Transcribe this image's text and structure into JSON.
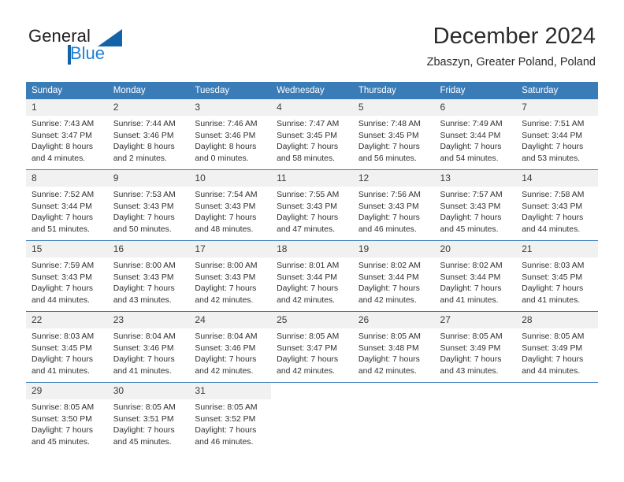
{
  "brand": {
    "name_primary": "General",
    "name_secondary": "Blue",
    "accent_color": "#1363a8",
    "blue_text_color": "#1f7fd4"
  },
  "header": {
    "title": "December 2024",
    "subtitle": "Zbaszyn, Greater Poland, Poland"
  },
  "calendar": {
    "header_bg": "#3a7cb8",
    "daynum_bg": "#f1f1f1",
    "weekday_headers": [
      "Sunday",
      "Monday",
      "Tuesday",
      "Wednesday",
      "Thursday",
      "Friday",
      "Saturday"
    ],
    "weeks": [
      [
        {
          "day": "1",
          "sunrise": "Sunrise: 7:43 AM",
          "sunset": "Sunset: 3:47 PM",
          "daylight": "Daylight: 8 hours and 4 minutes."
        },
        {
          "day": "2",
          "sunrise": "Sunrise: 7:44 AM",
          "sunset": "Sunset: 3:46 PM",
          "daylight": "Daylight: 8 hours and 2 minutes."
        },
        {
          "day": "3",
          "sunrise": "Sunrise: 7:46 AM",
          "sunset": "Sunset: 3:46 PM",
          "daylight": "Daylight: 8 hours and 0 minutes."
        },
        {
          "day": "4",
          "sunrise": "Sunrise: 7:47 AM",
          "sunset": "Sunset: 3:45 PM",
          "daylight": "Daylight: 7 hours and 58 minutes."
        },
        {
          "day": "5",
          "sunrise": "Sunrise: 7:48 AM",
          "sunset": "Sunset: 3:45 PM",
          "daylight": "Daylight: 7 hours and 56 minutes."
        },
        {
          "day": "6",
          "sunrise": "Sunrise: 7:49 AM",
          "sunset": "Sunset: 3:44 PM",
          "daylight": "Daylight: 7 hours and 54 minutes."
        },
        {
          "day": "7",
          "sunrise": "Sunrise: 7:51 AM",
          "sunset": "Sunset: 3:44 PM",
          "daylight": "Daylight: 7 hours and 53 minutes."
        }
      ],
      [
        {
          "day": "8",
          "sunrise": "Sunrise: 7:52 AM",
          "sunset": "Sunset: 3:44 PM",
          "daylight": "Daylight: 7 hours and 51 minutes."
        },
        {
          "day": "9",
          "sunrise": "Sunrise: 7:53 AM",
          "sunset": "Sunset: 3:43 PM",
          "daylight": "Daylight: 7 hours and 50 minutes."
        },
        {
          "day": "10",
          "sunrise": "Sunrise: 7:54 AM",
          "sunset": "Sunset: 3:43 PM",
          "daylight": "Daylight: 7 hours and 48 minutes."
        },
        {
          "day": "11",
          "sunrise": "Sunrise: 7:55 AM",
          "sunset": "Sunset: 3:43 PM",
          "daylight": "Daylight: 7 hours and 47 minutes."
        },
        {
          "day": "12",
          "sunrise": "Sunrise: 7:56 AM",
          "sunset": "Sunset: 3:43 PM",
          "daylight": "Daylight: 7 hours and 46 minutes."
        },
        {
          "day": "13",
          "sunrise": "Sunrise: 7:57 AM",
          "sunset": "Sunset: 3:43 PM",
          "daylight": "Daylight: 7 hours and 45 minutes."
        },
        {
          "day": "14",
          "sunrise": "Sunrise: 7:58 AM",
          "sunset": "Sunset: 3:43 PM",
          "daylight": "Daylight: 7 hours and 44 minutes."
        }
      ],
      [
        {
          "day": "15",
          "sunrise": "Sunrise: 7:59 AM",
          "sunset": "Sunset: 3:43 PM",
          "daylight": "Daylight: 7 hours and 44 minutes."
        },
        {
          "day": "16",
          "sunrise": "Sunrise: 8:00 AM",
          "sunset": "Sunset: 3:43 PM",
          "daylight": "Daylight: 7 hours and 43 minutes."
        },
        {
          "day": "17",
          "sunrise": "Sunrise: 8:00 AM",
          "sunset": "Sunset: 3:43 PM",
          "daylight": "Daylight: 7 hours and 42 minutes."
        },
        {
          "day": "18",
          "sunrise": "Sunrise: 8:01 AM",
          "sunset": "Sunset: 3:44 PM",
          "daylight": "Daylight: 7 hours and 42 minutes."
        },
        {
          "day": "19",
          "sunrise": "Sunrise: 8:02 AM",
          "sunset": "Sunset: 3:44 PM",
          "daylight": "Daylight: 7 hours and 42 minutes."
        },
        {
          "day": "20",
          "sunrise": "Sunrise: 8:02 AM",
          "sunset": "Sunset: 3:44 PM",
          "daylight": "Daylight: 7 hours and 41 minutes."
        },
        {
          "day": "21",
          "sunrise": "Sunrise: 8:03 AM",
          "sunset": "Sunset: 3:45 PM",
          "daylight": "Daylight: 7 hours and 41 minutes."
        }
      ],
      [
        {
          "day": "22",
          "sunrise": "Sunrise: 8:03 AM",
          "sunset": "Sunset: 3:45 PM",
          "daylight": "Daylight: 7 hours and 41 minutes."
        },
        {
          "day": "23",
          "sunrise": "Sunrise: 8:04 AM",
          "sunset": "Sunset: 3:46 PM",
          "daylight": "Daylight: 7 hours and 41 minutes."
        },
        {
          "day": "24",
          "sunrise": "Sunrise: 8:04 AM",
          "sunset": "Sunset: 3:46 PM",
          "daylight": "Daylight: 7 hours and 42 minutes."
        },
        {
          "day": "25",
          "sunrise": "Sunrise: 8:05 AM",
          "sunset": "Sunset: 3:47 PM",
          "daylight": "Daylight: 7 hours and 42 minutes."
        },
        {
          "day": "26",
          "sunrise": "Sunrise: 8:05 AM",
          "sunset": "Sunset: 3:48 PM",
          "daylight": "Daylight: 7 hours and 42 minutes."
        },
        {
          "day": "27",
          "sunrise": "Sunrise: 8:05 AM",
          "sunset": "Sunset: 3:49 PM",
          "daylight": "Daylight: 7 hours and 43 minutes."
        },
        {
          "day": "28",
          "sunrise": "Sunrise: 8:05 AM",
          "sunset": "Sunset: 3:49 PM",
          "daylight": "Daylight: 7 hours and 44 minutes."
        }
      ],
      [
        {
          "day": "29",
          "sunrise": "Sunrise: 8:05 AM",
          "sunset": "Sunset: 3:50 PM",
          "daylight": "Daylight: 7 hours and 45 minutes."
        },
        {
          "day": "30",
          "sunrise": "Sunrise: 8:05 AM",
          "sunset": "Sunset: 3:51 PM",
          "daylight": "Daylight: 7 hours and 45 minutes."
        },
        {
          "day": "31",
          "sunrise": "Sunrise: 8:05 AM",
          "sunset": "Sunset: 3:52 PM",
          "daylight": "Daylight: 7 hours and 46 minutes."
        },
        {
          "day": "",
          "sunrise": "",
          "sunset": "",
          "daylight": ""
        },
        {
          "day": "",
          "sunrise": "",
          "sunset": "",
          "daylight": ""
        },
        {
          "day": "",
          "sunrise": "",
          "sunset": "",
          "daylight": ""
        },
        {
          "day": "",
          "sunrise": "",
          "sunset": "",
          "daylight": ""
        }
      ]
    ]
  }
}
